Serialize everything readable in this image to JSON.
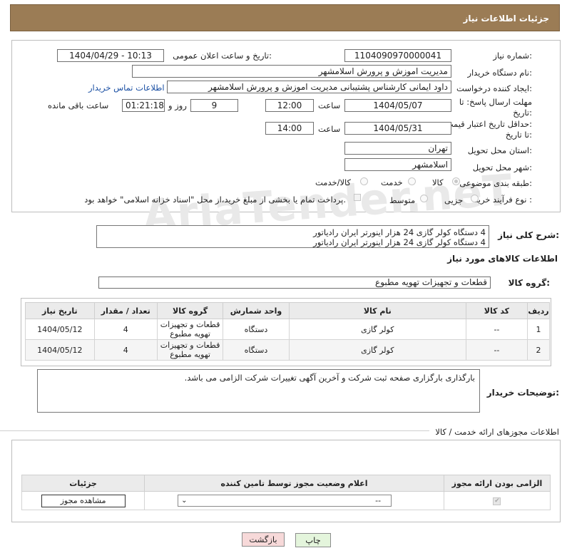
{
  "header": {
    "title": "جزئیات اطلاعات نیاز"
  },
  "watermark": {
    "text": "AriaTender.neT"
  },
  "form": {
    "need_number": {
      "label": "شماره نیاز:",
      "value": "1104090970000041"
    },
    "announce": {
      "label": "تاریخ و ساعت اعلان عمومی:",
      "value": "1404/04/29 - 10:13"
    },
    "buyer_org": {
      "label": "نام دستگاه خریدار:",
      "value": "مدیریت اموزش و پرورش اسلامشهر"
    },
    "requester": {
      "label": "ایجاد کننده درخواست:",
      "value": "داود ایمانی کارشناس پشتیبانی مدیریت اموزش و پرورش اسلامشهر",
      "contact_link": "اطلاعات تماس خریدار"
    },
    "deadline": {
      "label_line1": "مهلت ارسال پاسخ: تا",
      "label_line2": "تاریخ:",
      "date": "1404/05/07",
      "time_label": "ساعت",
      "time": "12:00",
      "days": "9",
      "days_label": "روز و",
      "remaining": "01:21:18",
      "remaining_label": "ساعت باقی مانده"
    },
    "validity": {
      "label_line1": "حداقل تاریخ اعتبار قیمت:",
      "label_line2": "تا تاریخ:",
      "date": "1404/05/31",
      "time_label": "ساعت",
      "time": "14:00"
    },
    "province": {
      "label": "استان محل تحویل:",
      "value": "تهران"
    },
    "city": {
      "label": "شهر محل تحویل:",
      "value": "اسلامشهر"
    },
    "category": {
      "label": "طبقه بندی موضوعی:",
      "options": [
        "کالا",
        "خدمت",
        "کالا/خدمت"
      ],
      "selected": "کالا"
    },
    "process": {
      "label": "نوع فرآیند خرید :",
      "options": [
        "جزیی",
        "متوسط"
      ],
      "note": "پرداخت تمام یا بخشی از مبلغ خرید،از محل \"اسناد خزانه اسلامی\" خواهد بود."
    }
  },
  "description": {
    "label": "شرح کلی نیاز:",
    "lines": [
      "4 دستگاه کولر گازی 24 هزار اینورتر ایران رادیاتور",
      "4  دستگاه کولر گازی 24 هزار اینورتر ایران رادیاتور"
    ]
  },
  "goods": {
    "section_title": "اطلاعات کالاهای مورد نیاز",
    "group_label": "گروه کالا:",
    "group_value": "قطعات و تجهیزات تهویه مطبوع",
    "columns": [
      "ردیف",
      "کد کالا",
      "نام کالا",
      "واحد شمارش",
      "گروه کالا",
      "تعداد / مقدار",
      "تاریخ نیاز"
    ],
    "rows": [
      {
        "row": "1",
        "code": "--",
        "name": "کولر گازی",
        "unit": "دستگاه",
        "group_line1": "قطعات و تجهیزات",
        "group_line2": "تهویه مطبوع",
        "qty": "4",
        "date": "1404/05/12"
      },
      {
        "row": "2",
        "code": "--",
        "name": "کولر گازی",
        "unit": "دستگاه",
        "group_line1": "قطعات و تجهیزات",
        "group_line2": "تهویه مطبوع",
        "qty": "4",
        "date": "1404/05/12"
      }
    ]
  },
  "buyer_notes": {
    "label": "توضیحات خریدار:",
    "text": "بارگذاری بارگزاری صفحه ثبت شرکت و آخرین آگهی تغییرات شرکت الزامی می باشد."
  },
  "permits": {
    "section_title": "اطلاعات مجوزهای ارائه خدمت / کالا",
    "columns": [
      "الزامی بودن ارائه مجوز",
      "اعلام وضعیت مجوز توسط تامین کننده",
      "جزئیات"
    ],
    "row": {
      "status_value": "--",
      "details_button": "مشاهده مجوز"
    }
  },
  "actions": {
    "print": "چاپ",
    "back": "بازگشت"
  },
  "colors": {
    "header_bg": "#9b7c55",
    "link": "#1a4fa3",
    "back_btn_bg": "#f7d9d9",
    "print_btn_bg": "#e4f5dc"
  }
}
